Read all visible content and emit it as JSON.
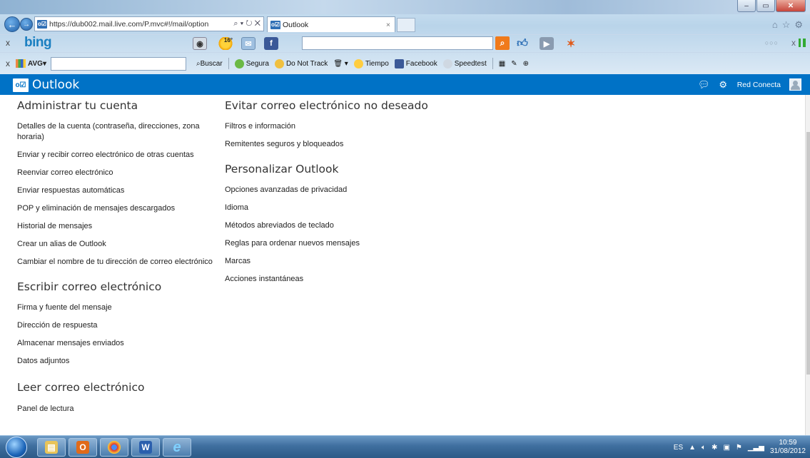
{
  "browser": {
    "address_url": "https://dub002.mail.live.com/P.mvc#!/mail/option",
    "address_host": "live.com",
    "tab_title": "Outlook",
    "search_box_value": "",
    "weather_temp": "16°",
    "toolbar_items": [
      "Buscar",
      "Segura",
      "Do Not Track",
      "Tiempo",
      "Facebook",
      "Speedtest"
    ],
    "avg_label": "AVG"
  },
  "outlook": {
    "app_title": "Outlook",
    "user_name": "Red Conecta"
  },
  "sections": {
    "account": {
      "title": "Administrar tu cuenta",
      "links": [
        "Detalles de la cuenta (contraseña, direcciones, zona horaria)",
        "Enviar y recibir correo electrónico de otras cuentas",
        "Reenviar correo electrónico",
        "Enviar respuestas automáticas",
        "POP y eliminación de mensajes descargados",
        "Historial de mensajes",
        "Crear un alias de Outlook",
        "Cambiar el nombre de tu dirección de correo electrónico"
      ]
    },
    "writing": {
      "title": "Escribir correo electrónico",
      "links": [
        "Firma y fuente del mensaje",
        "Dirección de respuesta",
        "Almacenar mensajes enviados",
        "Datos adjuntos"
      ]
    },
    "reading": {
      "title": "Leer correo electrónico",
      "links": [
        "Panel de lectura"
      ]
    },
    "junk": {
      "title": "Evitar correo electrónico no deseado",
      "links": [
        "Filtros e información",
        "Remitentes seguros y bloqueados"
      ]
    },
    "customize": {
      "title": "Personalizar Outlook",
      "links": [
        "Opciones avanzadas de privacidad",
        "Idioma",
        "Métodos abreviados de teclado",
        "Reglas para ordenar nuevos mensajes",
        "Marcas",
        "Acciones instantáneas"
      ]
    }
  },
  "taskbar": {
    "language": "ES",
    "time": "10:59",
    "date": "31/08/2012"
  },
  "colors": {
    "outlook_blue": "#0072c6"
  }
}
